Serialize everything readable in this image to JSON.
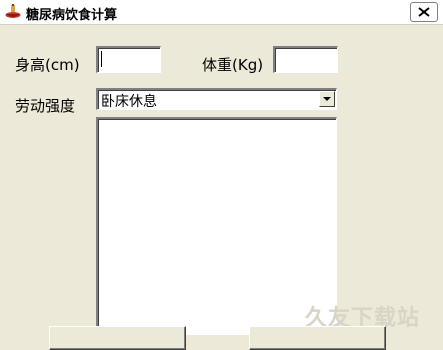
{
  "window": {
    "title": "糖尿病饮食计算"
  },
  "form": {
    "height_label": "身高(cm)",
    "height_value": "",
    "weight_label": "体重(Kg)",
    "weight_value": "",
    "labor_label": "劳动强度",
    "labor_selected": "卧床休息",
    "result_text": ""
  },
  "watermark": "久友下载站",
  "icons": {
    "app": "food-bowl-icon",
    "close": "close-icon",
    "dropdown": "chevron-down-icon"
  }
}
